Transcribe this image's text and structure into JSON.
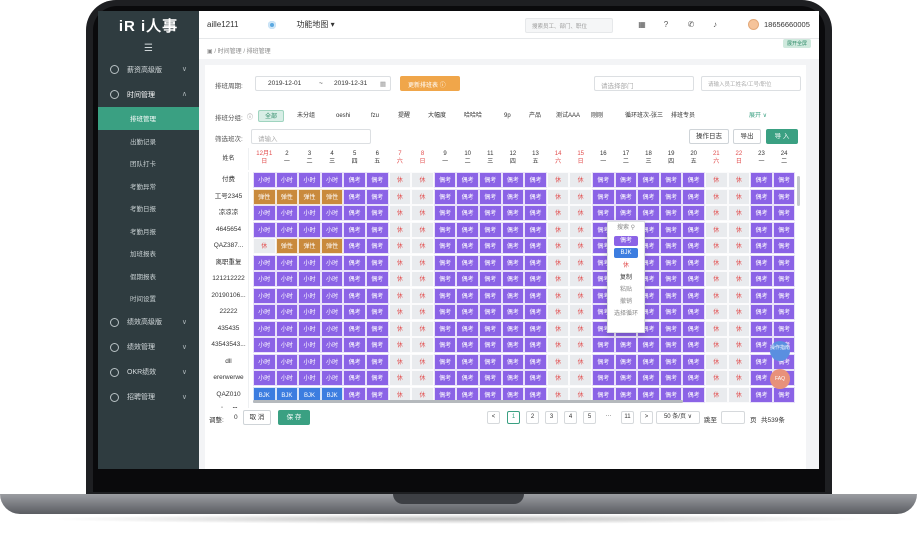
{
  "app": {
    "logo": "iR i人事",
    "company": "aille1211",
    "func_map": "功能地图 ▾",
    "search_placeholder": "搜索员工、部门、职位",
    "phone": "18656660005"
  },
  "sidebar": {
    "groups": [
      {
        "label": "薪资高级版",
        "chev": "∨"
      },
      {
        "label": "时间管理",
        "chev": "∧"
      }
    ],
    "subitems": [
      "排班管理",
      "出勤记录",
      "团队打卡",
      "考勤异常",
      "考勤日报",
      "考勤月报",
      "加班报表",
      "假期报表",
      "时间设置"
    ],
    "groups2": [
      {
        "label": "绩效高级版",
        "chev": "∨"
      },
      {
        "label": "绩效管理",
        "chev": "∨"
      },
      {
        "label": "OKR绩效",
        "chev": "∨"
      },
      {
        "label": "招聘管理",
        "chev": "∨"
      }
    ]
  },
  "breadcrumb": "/ 时间管理 / 排班管理",
  "expand_all": "展开全屏",
  "filters": {
    "period_label": "排班周期:",
    "start": "2019-12-01",
    "sep": "~",
    "end": "2019-12-31",
    "update_btn": "更新排班表",
    "dept_placeholder": "请选择部门",
    "emp_placeholder": "请输入员工姓名/工号/职位",
    "group_label": "排班分组:",
    "groups": [
      "全部",
      "未分组",
      "oeshi",
      "fzu",
      "提醒",
      "大幅度",
      "哈哈哈",
      "9p",
      "产品",
      "测试AAA",
      "刚刚",
      "循环班次-张三",
      "排班专员"
    ],
    "expand": "展开 ∨",
    "shift_label": "筛选班次:",
    "shift_placeholder": "请输入",
    "log_btn": "操作日志",
    "export_btn": "导出",
    "import_btn": "导 入"
  },
  "grid": {
    "name_header": "姓名",
    "days": [
      {
        "d": "12月1",
        "w": "日",
        "red": true
      },
      {
        "d": "2",
        "w": "一",
        "red": false
      },
      {
        "d": "3",
        "w": "二",
        "red": false
      },
      {
        "d": "4",
        "w": "三",
        "red": false
      },
      {
        "d": "5",
        "w": "四",
        "red": false
      },
      {
        "d": "6",
        "w": "五",
        "red": false
      },
      {
        "d": "7",
        "w": "六",
        "red": true
      },
      {
        "d": "8",
        "w": "日",
        "red": true
      },
      {
        "d": "9",
        "w": "一",
        "red": false
      },
      {
        "d": "10",
        "w": "二",
        "red": false
      },
      {
        "d": "11",
        "w": "三",
        "red": false
      },
      {
        "d": "12",
        "w": "四",
        "red": false
      },
      {
        "d": "13",
        "w": "五",
        "red": false
      },
      {
        "d": "14",
        "w": "六",
        "red": true
      },
      {
        "d": "15",
        "w": "日",
        "red": true
      },
      {
        "d": "16",
        "w": "一",
        "red": false
      },
      {
        "d": "17",
        "w": "二",
        "red": false
      },
      {
        "d": "18",
        "w": "三",
        "red": false
      },
      {
        "d": "19",
        "w": "四",
        "red": false
      },
      {
        "d": "20",
        "w": "五",
        "red": false
      },
      {
        "d": "21",
        "w": "六",
        "red": true
      },
      {
        "d": "22",
        "w": "日",
        "red": true
      },
      {
        "d": "23",
        "w": "一",
        "red": false
      },
      {
        "d": "24",
        "w": "二",
        "red": false
      }
    ],
    "rows": [
      {
        "name": "付费",
        "cells": [
          "小时",
          "小时",
          "小时",
          "小时",
          "偶考",
          "偶考",
          "休",
          "休",
          "偶考",
          "偶考",
          "偶考",
          "偶考",
          "偶考",
          "休",
          "休",
          "偶考",
          "偶考",
          "偶考",
          "偶考",
          "偶考",
          "休",
          "休",
          "偶考",
          "偶考"
        ]
      },
      {
        "name": "工号2345",
        "cells": [
          "弹性",
          "弹性",
          "弹性",
          "弹性",
          "偶考",
          "偶考",
          "休",
          "休",
          "偶考",
          "偶考",
          "偶考",
          "偶考",
          "偶考",
          "休",
          "休",
          "偶考",
          "偶考",
          "偶考",
          "偶考",
          "偶考",
          "休",
          "休",
          "偶考",
          "偶考"
        ]
      },
      {
        "name": "凉凉凉",
        "cells": [
          "小时",
          "小时",
          "小时",
          "小时",
          "偶考",
          "偶考",
          "休",
          "休",
          "偶考",
          "偶考",
          "偶考",
          "偶考",
          "偶考",
          "休",
          "休",
          "偶考",
          "偶考",
          "偶考",
          "偶考",
          "偶考",
          "休",
          "休",
          "偶考",
          "偶考"
        ]
      },
      {
        "name": "4645654",
        "cells": [
          "小时",
          "小时",
          "小时",
          "小时",
          "偶考",
          "偶考",
          "休",
          "休",
          "偶考",
          "偶考",
          "偶考",
          "偶考",
          "偶考",
          "休",
          "休",
          "偶考",
          "偶考",
          "偶考",
          "偶考",
          "偶考",
          "休",
          "休",
          "偶考",
          "偶考"
        ]
      },
      {
        "name": "QAZ387...",
        "cells": [
          "休",
          "弹性",
          "弹性",
          "弹性",
          "偶考",
          "偶考",
          "休",
          "休",
          "偶考",
          "偶考",
          "偶考",
          "偶考",
          "偶考",
          "休",
          "休",
          "偶考",
          "偶考",
          "偶考",
          "偶考",
          "偶考",
          "休",
          "休",
          "偶考",
          "偶考"
        ]
      },
      {
        "name": "离职重复",
        "cells": [
          "小时",
          "小时",
          "小时",
          "小时",
          "偶考",
          "偶考",
          "休",
          "休",
          "偶考",
          "偶考",
          "偶考",
          "偶考",
          "偶考",
          "休",
          "休",
          "偶考",
          "偶考",
          "偶考",
          "偶考",
          "偶考",
          "休",
          "休",
          "偶考",
          "偶考"
        ]
      },
      {
        "name": "121212222",
        "cells": [
          "小时",
          "小时",
          "小时",
          "小时",
          "偶考",
          "偶考",
          "休",
          "休",
          "偶考",
          "偶考",
          "偶考",
          "偶考",
          "偶考",
          "休",
          "休",
          "偶考",
          "偶考",
          "偶考",
          "偶考",
          "偶考",
          "休",
          "休",
          "偶考",
          "偶考"
        ]
      },
      {
        "name": "20190106...",
        "cells": [
          "小时",
          "小时",
          "小时",
          "小时",
          "偶考",
          "偶考",
          "休",
          "休",
          "偶考",
          "偶考",
          "偶考",
          "偶考",
          "偶考",
          "休",
          "休",
          "偶考",
          "偶考",
          "偶考",
          "偶考",
          "偶考",
          "休",
          "休",
          "偶考",
          "偶考"
        ]
      },
      {
        "name": "22222",
        "cells": [
          "小时",
          "小时",
          "小时",
          "小时",
          "偶考",
          "偶考",
          "休",
          "休",
          "偶考",
          "偶考",
          "偶考",
          "偶考",
          "偶考",
          "休",
          "休",
          "偶考",
          "偶考",
          "偶考",
          "偶考",
          "偶考",
          "休",
          "休",
          "偶考",
          "偶考"
        ]
      },
      {
        "name": "435435",
        "cells": [
          "小时",
          "小时",
          "小时",
          "小时",
          "偶考",
          "偶考",
          "休",
          "休",
          "偶考",
          "偶考",
          "偶考",
          "偶考",
          "偶考",
          "休",
          "休",
          "偶考",
          "偶考",
          "偶考",
          "偶考",
          "偶考",
          "休",
          "休",
          "偶考",
          "偶考"
        ]
      },
      {
        "name": "43543543...",
        "cells": [
          "小时",
          "小时",
          "小时",
          "小时",
          "偶考",
          "偶考",
          "休",
          "休",
          "偶考",
          "偶考",
          "偶考",
          "偶考",
          "偶考",
          "休",
          "休",
          "偶考",
          "偶考",
          "偶考",
          "偶考",
          "偶考",
          "休",
          "休",
          "偶考",
          "偶考"
        ]
      },
      {
        "name": "dll",
        "cells": [
          "小时",
          "小时",
          "小时",
          "小时",
          "偶考",
          "偶考",
          "休",
          "休",
          "偶考",
          "偶考",
          "偶考",
          "偶考",
          "偶考",
          "休",
          "休",
          "偶考",
          "偶考",
          "偶考",
          "偶考",
          "偶考",
          "休",
          "休",
          "偶考",
          "偶考"
        ]
      },
      {
        "name": "ererwerwe",
        "cells": [
          "小时",
          "小时",
          "小时",
          "小时",
          "偶考",
          "偶考",
          "休",
          "休",
          "偶考",
          "偶考",
          "偶考",
          "偶考",
          "偶考",
          "休",
          "休",
          "偶考",
          "偶考",
          "偶考",
          "偶考",
          "偶考",
          "休",
          "休",
          "偶考",
          "偶考"
        ]
      },
      {
        "name": "QAZ010",
        "cells": [
          "BJK",
          "BJK",
          "BJK",
          "BJK",
          "偶考",
          "偶考",
          "休",
          "休",
          "偶考",
          "偶考",
          "偶考",
          "偶考",
          "偶考",
          "休",
          "休",
          "偶考",
          "偶考",
          "偶考",
          "偶考",
          "偶考",
          "休",
          "休",
          "偶考",
          "偶考"
        ]
      },
      {
        "name": "十一号",
        "cells": []
      }
    ]
  },
  "popup": {
    "search": "搜索",
    "chip1": "偶考",
    "chip2": "BJK",
    "rest": "休",
    "copy": "复制",
    "paste": "粘贴",
    "undo": "撤销",
    "cycle": "选择循环"
  },
  "footer": {
    "adjust_label": "调整:",
    "adjust_count": "0",
    "cancel": "取 消",
    "save": "保 存",
    "prev": "<",
    "pages": [
      "1",
      "2",
      "3",
      "4",
      "5",
      "···",
      "11"
    ],
    "next": ">",
    "per_page": "50 条/页 ∨",
    "jump_label": "跳至",
    "page_unit": "页",
    "total": "共539条"
  },
  "float": {
    "op": "操作指南",
    "faq": "FAQ"
  },
  "colors": {
    "accent": "#3aa082",
    "purple": "#8b63e6",
    "brown": "#c98a3d",
    "blue": "#3c7de0",
    "orange": "#f0a64a"
  }
}
